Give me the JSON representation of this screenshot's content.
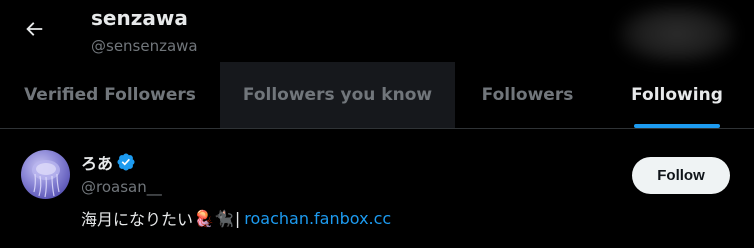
{
  "header": {
    "name": "senzawa",
    "handle": "@sensenzawa"
  },
  "tabs": [
    {
      "label": "Verified Followers",
      "state": "normal"
    },
    {
      "label": "Followers you know",
      "state": "hovered"
    },
    {
      "label": "Followers",
      "state": "normal"
    },
    {
      "label": "Following",
      "state": "active"
    }
  ],
  "user": {
    "name": "ろあ",
    "verified": true,
    "handle": "@roasan__",
    "bio_text": "海月になりたい",
    "bio_emojis": "🪼🐈‍⬛",
    "bio_separator": "|",
    "bio_link": "roachan.fanbox.cc",
    "follow_label": "Follow"
  },
  "colors": {
    "background": "#000000",
    "accent": "#1d9bf0",
    "muted_text": "#71767b",
    "primary_text": "#e7e9ea",
    "button_bg": "#eff3f4"
  },
  "icons": {
    "back": "arrow-left-icon",
    "verified": "verified-badge-icon"
  }
}
